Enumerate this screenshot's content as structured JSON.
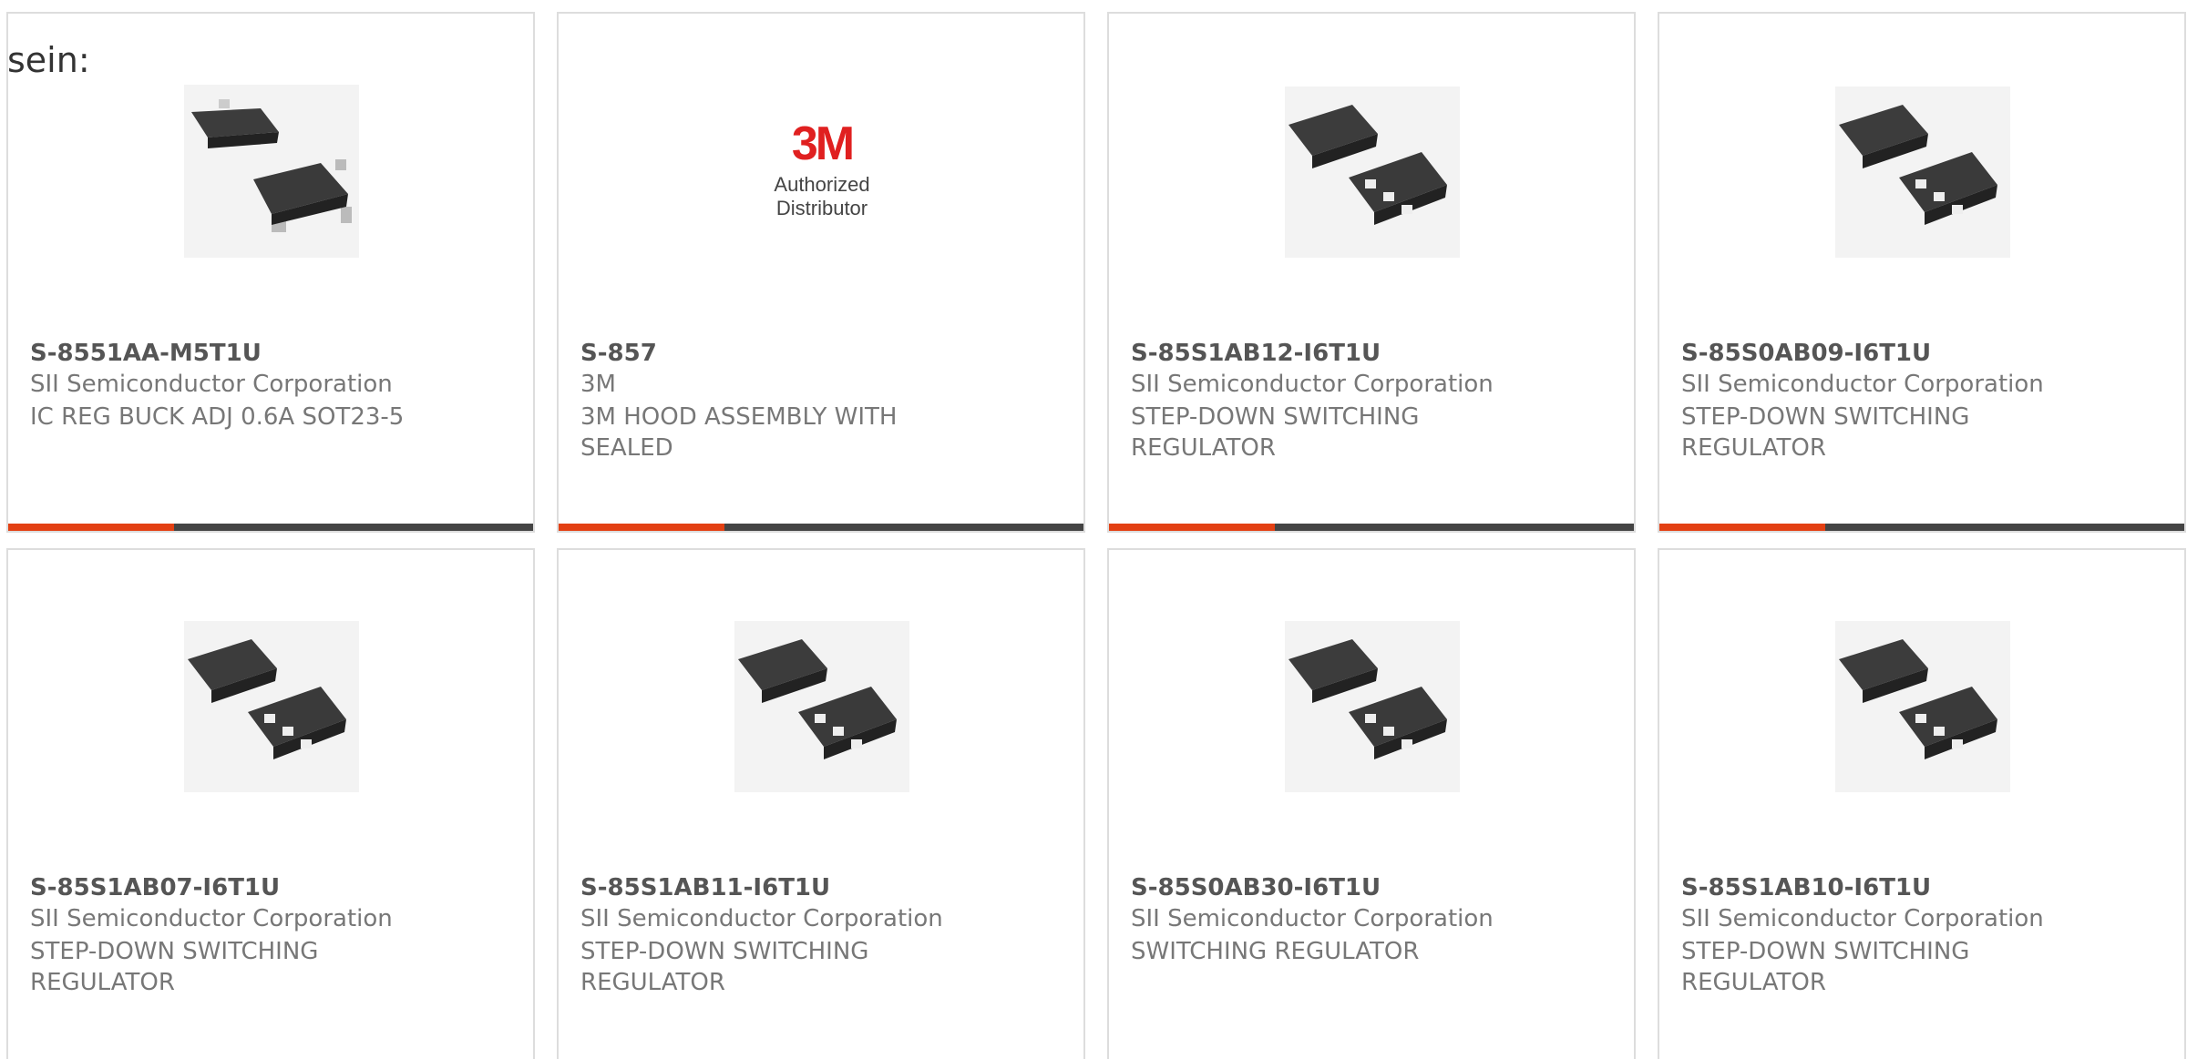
{
  "intro_text": "sein:",
  "products": [
    {
      "part": "S-8551AA-M5T1U",
      "manufacturer": "SII Semiconductor Corporation",
      "description": "IC REG BUCK ADJ 0.6A SOT23-5",
      "image": "sot23-5-chip-icon"
    },
    {
      "part": "S-857",
      "manufacturer": "3M",
      "description": "3M HOOD ASSEMBLY WITH SEALED",
      "image": "3m-logo",
      "logo_text": "3M",
      "logo_caption": "Authorized Distributor"
    },
    {
      "part": "S-85S1AB12-I6T1U",
      "manufacturer": "SII Semiconductor Corporation",
      "description": "STEP-DOWN SWITCHING REGULATOR",
      "image": "snt-chip-icon"
    },
    {
      "part": "S-85S0AB09-I6T1U",
      "manufacturer": "SII Semiconductor Corporation",
      "description": "STEP-DOWN SWITCHING REGULATOR",
      "image": "snt-chip-icon"
    },
    {
      "part": "S-85S1AB07-I6T1U",
      "manufacturer": "SII Semiconductor Corporation",
      "description": "STEP-DOWN SWITCHING REGULATOR",
      "image": "snt-chip-icon"
    },
    {
      "part": "S-85S1AB11-I6T1U",
      "manufacturer": "SII Semiconductor Corporation",
      "description": "STEP-DOWN SWITCHING REGULATOR",
      "image": "snt-chip-icon"
    },
    {
      "part": "S-85S0AB30-I6T1U",
      "manufacturer": "SII Semiconductor Corporation",
      "description": "SWITCHING REGULATOR",
      "image": "snt-chip-icon"
    },
    {
      "part": "S-85S1AB10-I6T1U",
      "manufacturer": "SII Semiconductor Corporation",
      "description": "STEP-DOWN SWITCHING REGULATOR",
      "image": "snt-chip-icon"
    }
  ],
  "colors": {
    "accent": "#e34013",
    "bar": "#444444",
    "border": "#dddddd"
  }
}
